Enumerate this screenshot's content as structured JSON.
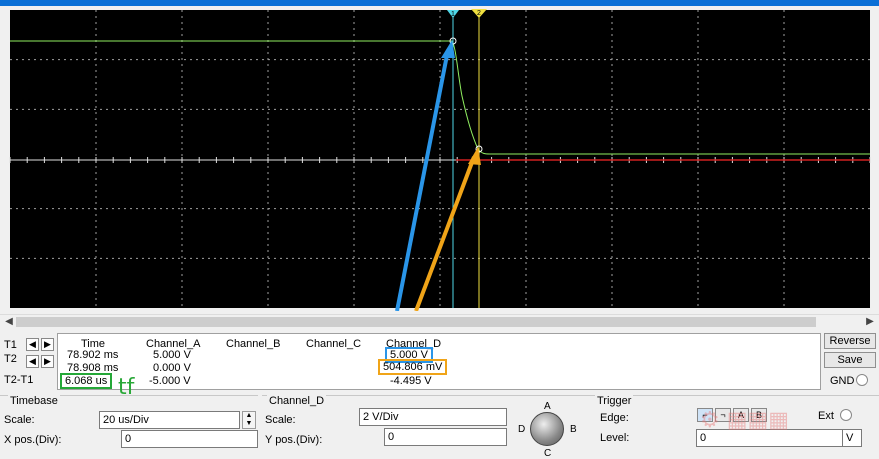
{
  "colors": {
    "screen": "#000000",
    "grid": "#c8c8c8",
    "trace_d": "#90ee60",
    "trace_red": "#d02020",
    "cursor1": "#50d8e8",
    "cursor2": "#f0e040",
    "arrow_blue": "#2a95e8",
    "arrow_orange": "#f0a418",
    "annotation_green": "#25a838"
  },
  "cursors": {
    "t1_tag": "1",
    "t2_tag": "2"
  },
  "scroll": {
    "left_icon": "arrow-left-icon",
    "right_icon": "arrow-right-icon"
  },
  "readout": {
    "rows": [
      "T1",
      "T2",
      "T2-T1"
    ],
    "headers": {
      "time": "Time",
      "a": "Channel_A",
      "b": "Channel_B",
      "c": "Channel_C",
      "d": "Channel_D"
    },
    "t1": {
      "time": "78.902 ms",
      "a": "5.000 V",
      "d": "5.000 V"
    },
    "t2": {
      "time": "78.908 ms",
      "a": "0.000 V",
      "d": "504.806 mV"
    },
    "diff": {
      "time": "6.068 us",
      "a": "-5.000 V",
      "d": "-4.495 V"
    }
  },
  "annotation": {
    "tf": "tf"
  },
  "buttons": {
    "reverse": "Reverse",
    "save": "Save",
    "gnd": "GND"
  },
  "timebase": {
    "title": "Timebase",
    "scale_label": "Scale:",
    "scale_value": "20 us/Div",
    "xpos_label": "X pos.(Div):",
    "xpos_value": "0"
  },
  "channel_d": {
    "title": "Channel_D",
    "scale_label": "Scale:",
    "scale_value": "2  V/Div",
    "ypos_label": "Y pos.(Div):",
    "ypos_value": "0"
  },
  "knob": {
    "a": "A",
    "b": "B",
    "c": "C",
    "d": "D"
  },
  "trigger": {
    "title": "Trigger",
    "edge_label": "Edge:",
    "level_label": "Level:",
    "level_value": "0",
    "ext_label": "Ext",
    "unit": "V"
  }
}
